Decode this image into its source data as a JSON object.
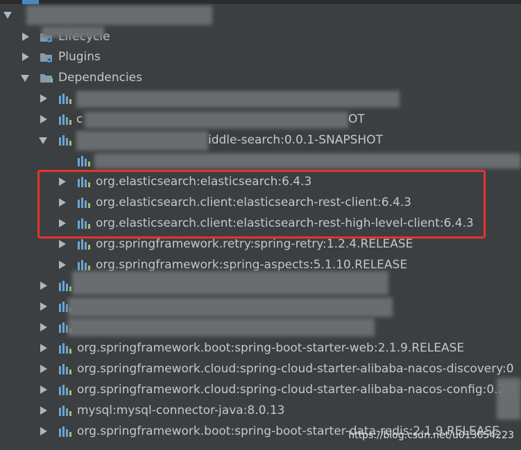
{
  "tree": {
    "folders": [
      {
        "label": "Lifecycle",
        "expanded": false
      },
      {
        "label": "Plugins",
        "expanded": false
      },
      {
        "label": "Dependencies",
        "expanded": true
      }
    ],
    "partial_rows": [
      {
        "text": "OT"
      },
      {
        "text": "iddle-search:0.0.1-SNAPSHOT"
      }
    ],
    "highlighted_deps": [
      {
        "label": "org.elasticsearch:elasticsearch:6.4.3"
      },
      {
        "label": "org.elasticsearch.client:elasticsearch-rest-client:6.4.3"
      },
      {
        "label": "org.elasticsearch.client:elasticsearch-rest-high-level-client:6.4.3"
      }
    ],
    "nested_deps": [
      {
        "label": "org.springframework.retry:spring-retry:1.2.4.RELEASE"
      },
      {
        "label": "org.springframework:spring-aspects:5.1.10.RELEASE"
      }
    ],
    "top_deps": [
      {
        "label": "org.springframework.boot:spring-boot-starter-web:2.1.9.RELEASE"
      },
      {
        "label": "org.springframework.cloud:spring-cloud-starter-alibaba-nacos-discovery:0"
      },
      {
        "label": "org.springframework.cloud:spring-cloud-starter-alibaba-nacos-config:0.2.2"
      },
      {
        "label": "mysql:mysql-connector-java:8.0.13"
      },
      {
        "label": "org.springframework.boot:spring-boot-starter-data-redis:2.1.9.RELEASE"
      }
    ]
  },
  "watermark": "https://blog.csdn.net/u013654223",
  "colors": {
    "highlight_box": "#e8332b",
    "background": "#3c3f41",
    "text": "#c5c7c9"
  }
}
